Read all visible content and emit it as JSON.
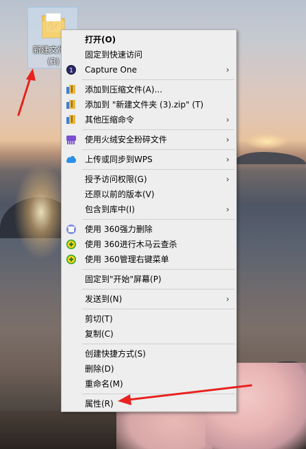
{
  "desktop_icon": {
    "label": "新建文件夹\n(3)"
  },
  "menu": {
    "items": [
      {
        "label": "打开(O)",
        "bold": true,
        "icon": "none"
      },
      {
        "label": "固定到快速访问",
        "icon": "none"
      },
      {
        "label": "Capture One",
        "icon": "capture-one-icon",
        "submenu": true
      },
      {
        "sep": true
      },
      {
        "label": "添加到压缩文件(A)...",
        "icon": "archive-icon"
      },
      {
        "label": "添加到 \"新建文件夹 (3).zip\" (T)",
        "icon": "archive-icon"
      },
      {
        "label": "其他压缩命令",
        "icon": "archive-icon",
        "submenu": true
      },
      {
        "sep": true
      },
      {
        "label": "使用火绒安全粉碎文件",
        "icon": "huorong-shredder-icon",
        "submenu": true
      },
      {
        "sep": true
      },
      {
        "label": "上传或同步到WPS",
        "icon": "wps-cloud-icon",
        "submenu": true
      },
      {
        "sep": true
      },
      {
        "label": "授予访问权限(G)",
        "icon": "none",
        "submenu": true
      },
      {
        "label": "还原以前的版本(V)",
        "icon": "none"
      },
      {
        "label": "包含到库中(I)",
        "icon": "none",
        "submenu": true
      },
      {
        "sep": true
      },
      {
        "label": "使用 360强力删除",
        "icon": "360-delete-icon"
      },
      {
        "label": "使用 360进行木马云查杀",
        "icon": "360-scan-icon"
      },
      {
        "label": "使用 360管理右键菜单",
        "icon": "360-manage-icon"
      },
      {
        "sep": true
      },
      {
        "label": "固定到\"开始\"屏幕(P)",
        "icon": "none"
      },
      {
        "sep": true
      },
      {
        "label": "发送到(N)",
        "icon": "none",
        "submenu": true
      },
      {
        "sep": true
      },
      {
        "label": "剪切(T)",
        "icon": "none"
      },
      {
        "label": "复制(C)",
        "icon": "none"
      },
      {
        "sep": true
      },
      {
        "label": "创建快捷方式(S)",
        "icon": "none"
      },
      {
        "label": "删除(D)",
        "icon": "none"
      },
      {
        "label": "重命名(M)",
        "icon": "none"
      },
      {
        "sep": true
      },
      {
        "label": "属性(R)",
        "icon": "none"
      }
    ],
    "submenu_arrow": "›"
  },
  "colors": {
    "menu_bg": "#eeeeee",
    "annotation_red": "#e8221e"
  }
}
